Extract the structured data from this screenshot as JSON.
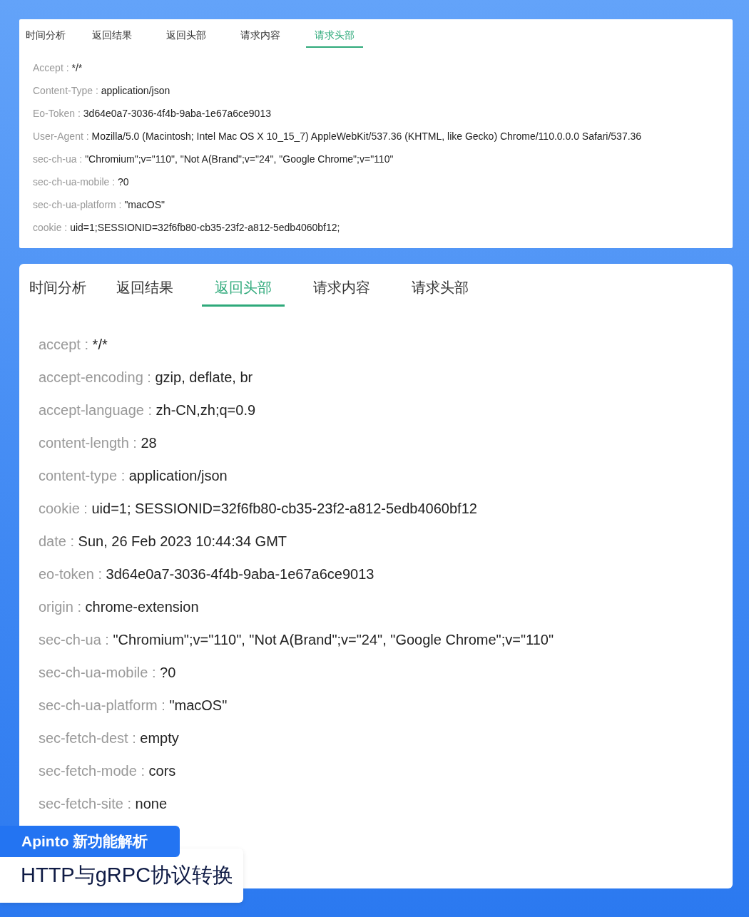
{
  "panels": [
    {
      "tabs": [
        {
          "label": "时间分析",
          "selected": false
        },
        {
          "label": "返回结果",
          "selected": false
        },
        {
          "label": "返回头部",
          "selected": false
        },
        {
          "label": "请求内容",
          "selected": false
        },
        {
          "label": "请求头部",
          "selected": true
        }
      ],
      "headers": [
        {
          "key": "Accept :",
          "value": "*/*"
        },
        {
          "key": "Content-Type :",
          "value": "application/json"
        },
        {
          "key": "Eo-Token :",
          "value": "3d64e0a7-3036-4f4b-9aba-1e67a6ce9013"
        },
        {
          "key": "User-Agent :",
          "value": "Mozilla/5.0 (Macintosh; Intel Mac OS X 10_15_7) AppleWebKit/537.36 (KHTML, like Gecko) Chrome/110.0.0.0 Safari/537.36"
        },
        {
          "key": "sec-ch-ua :",
          "value": "\"Chromium\";v=\"110\", \"Not A(Brand\";v=\"24\", \"Google Chrome\";v=\"110\""
        },
        {
          "key": "sec-ch-ua-mobile :",
          "value": "?0"
        },
        {
          "key": "sec-ch-ua-platform :",
          "value": "\"macOS\""
        },
        {
          "key": "cookie :",
          "value": "uid=1;SESSIONID=32f6fb80-cb35-23f2-a812-5edb4060bf12;"
        }
      ]
    },
    {
      "tabs": [
        {
          "label": "时间分析",
          "selected": false
        },
        {
          "label": "返回结果",
          "selected": false
        },
        {
          "label": "返回头部",
          "selected": true
        },
        {
          "label": "请求内容",
          "selected": false
        },
        {
          "label": "请求头部",
          "selected": false
        }
      ],
      "headers": [
        {
          "key": "accept :",
          "value": "*/*"
        },
        {
          "key": "accept-encoding :",
          "value": "gzip, deflate, br"
        },
        {
          "key": "accept-language :",
          "value": "zh-CN,zh;q=0.9"
        },
        {
          "key": "content-length :",
          "value": "28"
        },
        {
          "key": "content-type :",
          "value": "application/json"
        },
        {
          "key": "cookie :",
          "value": "uid=1; SESSIONID=32f6fb80-cb35-23f2-a812-5edb4060bf12"
        },
        {
          "key": "date :",
          "value": "Sun, 26 Feb 2023 10:44:34 GMT"
        },
        {
          "key": "eo-token :",
          "value": "3d64e0a7-3036-4f4b-9aba-1e67a6ce9013"
        },
        {
          "key": "origin :",
          "value": "chrome-extension"
        },
        {
          "key": "sec-ch-ua :",
          "value": "\"Chromium\";v=\"110\", \"Not A(Brand\";v=\"24\", \"Google Chrome\";v=\"110\""
        },
        {
          "key": "sec-ch-ua-mobile :",
          "value": "?0"
        },
        {
          "key": "sec-ch-ua-platform :",
          "value": "\"macOS\""
        },
        {
          "key": "sec-fetch-dest :",
          "value": "empty"
        },
        {
          "key": "sec-fetch-mode :",
          "value": "cors"
        },
        {
          "key": "sec-fetch-site :",
          "value": "none"
        }
      ]
    }
  ],
  "banner": {
    "tag": "Apinto 新功能解析",
    "title": "HTTP与gRPC协议转换"
  }
}
